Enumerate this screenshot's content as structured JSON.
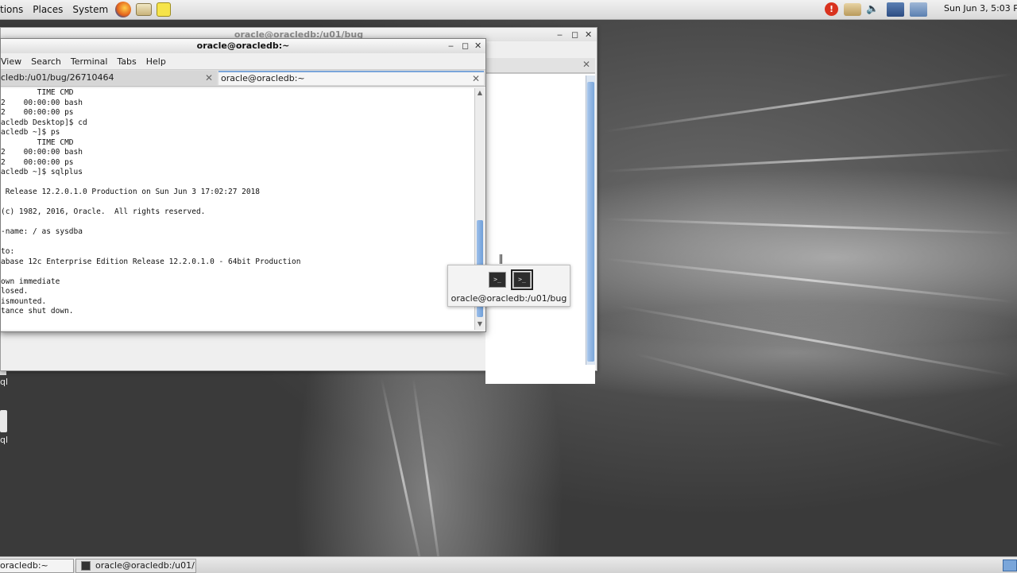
{
  "top_panel": {
    "applications_label": "tions",
    "places_label": "Places",
    "system_label": "System",
    "clock": "Sun Jun  3,  5:03 P"
  },
  "back_window": {
    "title": "oracle@oracledb:/u01/bug"
  },
  "terminal": {
    "title": "oracle@oracledb:~",
    "menu": [
      "View",
      "Search",
      "Terminal",
      "Tabs",
      "Help"
    ],
    "tabs": [
      {
        "label": "cledb:/u01/bug/26710464",
        "active": false
      },
      {
        "label": "oracle@oracledb:~",
        "active": true
      }
    ],
    "lines": [
      "        TIME CMD",
      "2    00:00:00 bash",
      "2    00:00:00 ps",
      "acledb Desktop]$ cd",
      "acledb ~]$ ps",
      "        TIME CMD",
      "2    00:00:00 bash",
      "2    00:00:00 ps",
      "acledb ~]$ sqlplus",
      "",
      " Release 12.2.0.1.0 Production on Sun Jun 3 17:02:27 2018",
      "",
      "(c) 1982, 2016, Oracle.  All rights reserved.",
      "",
      "-name: / as sysdba",
      "",
      "to:",
      "abase 12c Enterprise Edition Release 12.2.0.1.0 - 64bit Production",
      "",
      "own immediate",
      "losed.",
      "ismounted.",
      "tance shut down."
    ]
  },
  "switcher": {
    "label": "oracle@oracledb:/u01/bug"
  },
  "desktop_icons": [
    {
      "label": "ql"
    },
    {
      "label": "ql"
    }
  ],
  "taskbar": {
    "items": [
      {
        "label": "oracledb:~"
      },
      {
        "label": "oracle@oracledb:/u01/..."
      }
    ]
  },
  "colors": {
    "selection_blue": "#7aa6da",
    "panel_bg": "#e0e0e0"
  }
}
